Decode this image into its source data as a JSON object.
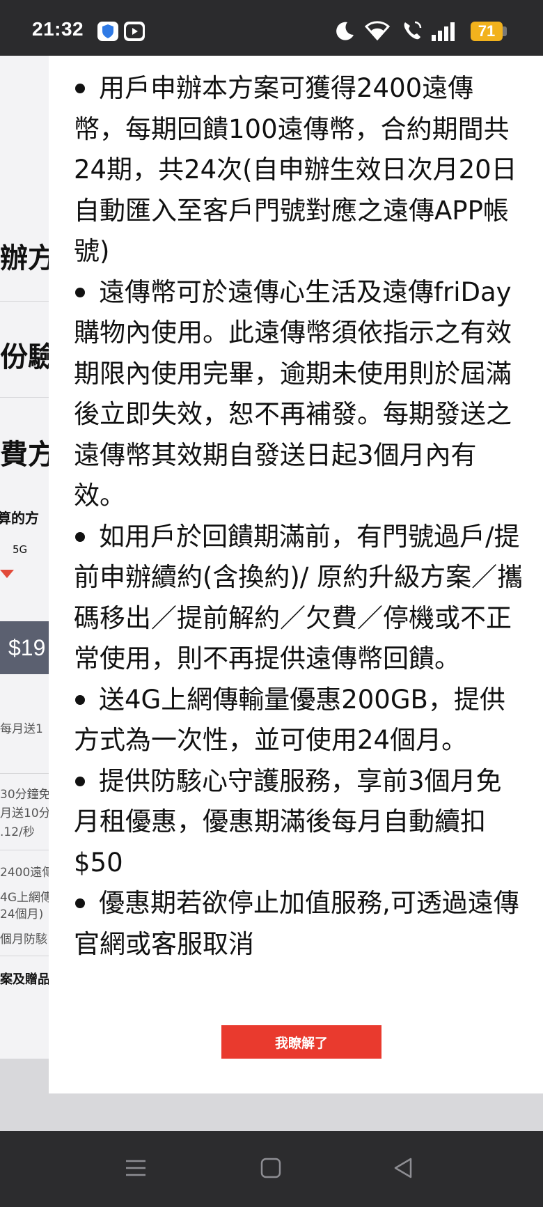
{
  "status_bar": {
    "time": "21:32",
    "battery": "71",
    "icons": [
      "shield-icon",
      "youtube-icon",
      "moon-icon",
      "wifi-icon",
      "call-icon",
      "signal-icon",
      "battery-icon"
    ]
  },
  "background": {
    "side_texts": [
      "辦方",
      "份驗",
      "費方",
      "算的方",
      "5G",
      "$19",
      "每月送1",
      "30分鐘免",
      "月送10分",
      ".12/秒",
      "2400遠傳",
      "4G上網傳",
      "24個月)",
      "個月防駭",
      "案及贈品"
    ]
  },
  "modal": {
    "items": [
      "用戶申辦本方案可獲得2400遠傳幣，每期回饋100遠傳幣，合約期間共24期，共24次(自申辦生效日次月20日自動匯入至客戶門號對應之遠傳APP帳號)",
      "遠傳幣可於遠傳心生活及遠傳friDay購物內使用。此遠傳幣須依指示之有效期限內使用完畢，逾期未使用則於屆滿後立即失效，恕不再補發。每期發送之遠傳幣其效期自發送日起3個月內有效。",
      "如用戶於回饋期滿前，有門號過戶/提前申辦續約(含換約)/ 原約升級方案／攜碼移出／提前解約／欠費／停機或不正常使用，則不再提供遠傳幣回饋。",
      "送4G上網傳輸量優惠200GB，提供方式為一次性，並可使用24個月。",
      "提供防駭心守護服務，享前3個月免月租優惠，優惠期滿後每月自動續扣$50",
      "優惠期若欲停止加值服務,可透過遠傳官網或客服取消"
    ],
    "confirm_label": "我瞭解了"
  },
  "nav_bar": {
    "icons": [
      "menu-icon",
      "home-icon",
      "back-icon"
    ]
  }
}
